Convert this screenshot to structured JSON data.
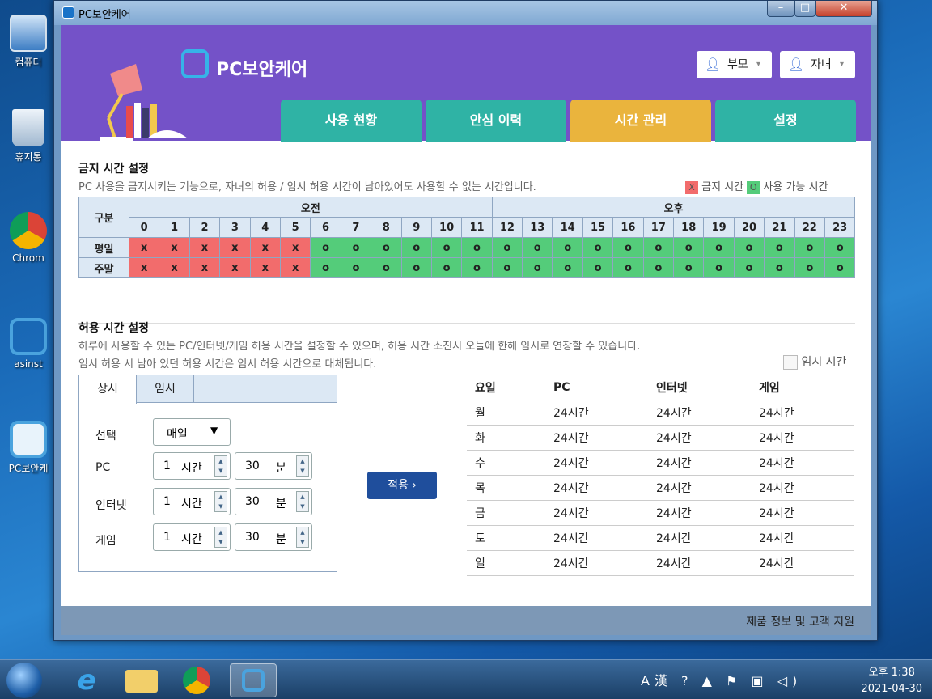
{
  "desktop": {
    "icons": [
      {
        "label": "컴퓨터",
        "icon": "computer-icon"
      },
      {
        "label": "휴지통",
        "icon": "recycle-bin-icon"
      },
      {
        "label": "Chrom",
        "icon": "chrome-icon"
      },
      {
        "label": "asinst",
        "icon": "asinst-icon"
      },
      {
        "label": "PC보안케",
        "icon": "pc-security-icon"
      }
    ]
  },
  "window": {
    "title": "PC보안케어",
    "controls": {
      "minimize": "–",
      "maximize": "□",
      "close": "✕"
    }
  },
  "header": {
    "logo": "PC보안케어",
    "users": [
      {
        "label": "부모",
        "caret": "▾"
      },
      {
        "label": "자녀",
        "caret": "▾"
      }
    ],
    "tabs": [
      "사용 현황",
      "안심 이력",
      "시간 관리",
      "설정"
    ],
    "active_tab": "시간 관리",
    "tab_colors": {
      "normal": "#2fb3a5",
      "active": "#eab43d"
    }
  },
  "prohibit": {
    "title": "금지 시간 설정",
    "description": "PC 사용을 금지시키는 기능으로, 자녀의 허용 / 임시 허용 시간이 남아있어도 사용할 수 없는 시간입니다.",
    "legend": {
      "x_mark": "X",
      "x_label": "금지 시간",
      "o_mark": "O",
      "o_label": "사용 가능 시간"
    },
    "col_header": "구분",
    "am": "오전",
    "pm": "오후",
    "hours": [
      "0",
      "1",
      "2",
      "3",
      "4",
      "5",
      "6",
      "7",
      "8",
      "9",
      "10",
      "11",
      "12",
      "13",
      "14",
      "15",
      "16",
      "17",
      "18",
      "19",
      "20",
      "21",
      "22",
      "23"
    ],
    "rows": [
      {
        "label": "평일",
        "cells": [
          "x",
          "x",
          "x",
          "x",
          "x",
          "x",
          "o",
          "o",
          "o",
          "o",
          "o",
          "o",
          "o",
          "o",
          "o",
          "o",
          "o",
          "o",
          "o",
          "o",
          "o",
          "o",
          "o",
          "o"
        ]
      },
      {
        "label": "주말",
        "cells": [
          "x",
          "x",
          "x",
          "x",
          "x",
          "x",
          "o",
          "o",
          "o",
          "o",
          "o",
          "o",
          "o",
          "o",
          "o",
          "o",
          "o",
          "o",
          "o",
          "o",
          "o",
          "o",
          "o",
          "o"
        ]
      }
    ]
  },
  "allow": {
    "title": "허용 시간 설정",
    "description1": "하루에 사용할 수 있는 PC/인터넷/게임 허용 시간을 설정할 수 있으며, 허용 시간 소진시 오늘에 한해 임시로 연장할 수 있습니다.",
    "description2": "임시 허용 시 남아 있던 허용 시간은 임시 허용 시간으로 대체됩니다.",
    "temp_checkbox": "임시 시간",
    "tabs": [
      "상시",
      "임시"
    ],
    "select_label": "선택",
    "select_value": "매일",
    "fields": [
      {
        "label": "PC",
        "hours": "1",
        "hour_unit": "시간",
        "minutes": "30",
        "min_unit": "분"
      },
      {
        "label": "인터넷",
        "hours": "1",
        "hour_unit": "시간",
        "minutes": "30",
        "min_unit": "분"
      },
      {
        "label": "게임",
        "hours": "1",
        "hour_unit": "시간",
        "minutes": "30",
        "min_unit": "분"
      }
    ],
    "apply_button": "적용 ›",
    "table": {
      "headers": [
        "요일",
        "PC",
        "인터넷",
        "게임"
      ],
      "rows": [
        [
          "월",
          "24시간",
          "24시간",
          "24시간"
        ],
        [
          "화",
          "24시간",
          "24시간",
          "24시간"
        ],
        [
          "수",
          "24시간",
          "24시간",
          "24시간"
        ],
        [
          "목",
          "24시간",
          "24시간",
          "24시간"
        ],
        [
          "금",
          "24시간",
          "24시간",
          "24시간"
        ],
        [
          "토",
          "24시간",
          "24시간",
          "24시간"
        ],
        [
          "일",
          "24시간",
          "24시간",
          "24시간"
        ]
      ]
    }
  },
  "footer": {
    "support": "제품 정보 및 고객 지원"
  },
  "taskbar": {
    "time": "오후 1:38",
    "date": "2021-04-30",
    "items": [
      "start-button",
      "ie-icon",
      "explorer-icon",
      "chrome-icon",
      "pc-security-icon"
    ]
  }
}
